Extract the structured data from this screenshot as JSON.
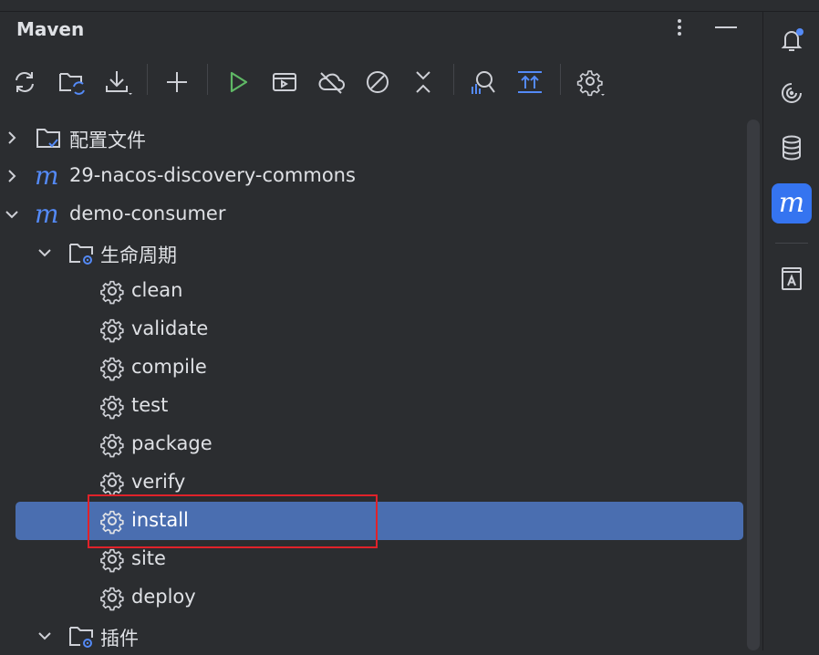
{
  "panel": {
    "title": "Maven",
    "more_icon": "vertical-ellipsis-icon",
    "minimize_icon": "minimize-icon"
  },
  "toolbar": {
    "buttons": [
      {
        "name": "reload-all-maven-projects",
        "icon": "refresh-icon"
      },
      {
        "name": "generate-sources-and-update-folders",
        "icon": "folder-refresh-icon"
      },
      {
        "name": "download-sources",
        "icon": "download-icon"
      },
      {
        "name": "add-maven-project",
        "icon": "plus-icon"
      },
      {
        "name": "run-maven-build",
        "icon": "run-icon"
      },
      {
        "name": "execute-maven-goal",
        "icon": "execute-goal-icon"
      },
      {
        "name": "toggle-offline-mode",
        "icon": "cloud-off-icon"
      },
      {
        "name": "skip-tests",
        "icon": "skip-icon"
      },
      {
        "name": "collapse-all",
        "icon": "collapse-icon"
      },
      {
        "name": "analyze-dependencies",
        "icon": "analyze-icon"
      },
      {
        "name": "show-diagram",
        "icon": "expand-all-icon"
      },
      {
        "name": "build-tool-settings",
        "icon": "settings-icon"
      }
    ],
    "accent_run": "#5fb865"
  },
  "tree": {
    "profiles": "配置文件",
    "project1": "29-nacos-discovery-commons",
    "project2": "demo-consumer",
    "lifecycle": "生命周期",
    "goals": [
      "clean",
      "validate",
      "compile",
      "test",
      "package",
      "verify",
      "install",
      "site",
      "deploy"
    ],
    "plugins": "插件",
    "selected_goal": "install"
  },
  "rightbar": {
    "items": [
      {
        "name": "notifications",
        "icon": "bell-icon",
        "has_badge": true
      },
      {
        "name": "ai-assistant",
        "icon": "swirl-icon"
      },
      {
        "name": "database",
        "icon": "database-icon"
      },
      {
        "name": "maven",
        "icon": "maven-icon",
        "active": true,
        "label": "m"
      },
      {
        "name": "reader-mode",
        "icon": "book-icon"
      }
    ]
  },
  "colors": {
    "background": "#2b2d30",
    "selection": "#4a6eb0",
    "accent_blue": "#3574f0",
    "highlight_red": "#e0222a",
    "maven_m": "#548af7"
  }
}
